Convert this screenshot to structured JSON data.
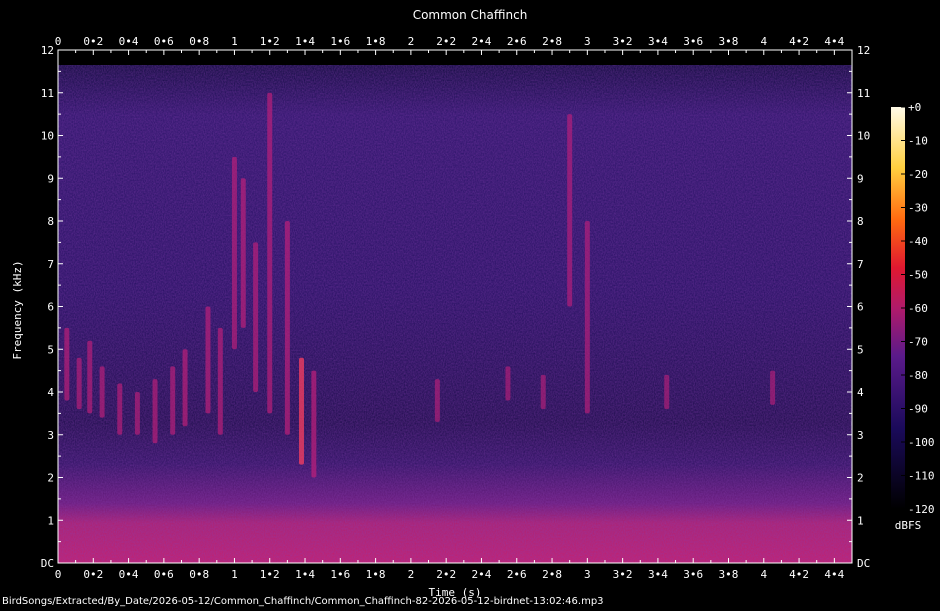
{
  "chart_data": {
    "type": "heatmap",
    "title": "Common Chaffinch",
    "xlabel": "Time (s)",
    "ylabel": "Frequency (kHz)",
    "xlim": [
      0,
      4.5
    ],
    "ylim": [
      0,
      12
    ],
    "x_ticks": [
      "0",
      "0•2",
      "0•4",
      "0•6",
      "0•8",
      "1",
      "1•2",
      "1•4",
      "1•6",
      "1•8",
      "2",
      "2•2",
      "2•4",
      "2•6",
      "2•8",
      "3",
      "3•2",
      "3•4",
      "3•6",
      "3•8",
      "4",
      "4•2",
      "4•4"
    ],
    "x_tick_values": [
      0,
      0.2,
      0.4,
      0.6,
      0.8,
      1.0,
      1.2,
      1.4,
      1.6,
      1.8,
      2.0,
      2.2,
      2.4,
      2.6,
      2.8,
      3.0,
      3.2,
      3.4,
      3.6,
      3.8,
      4.0,
      4.2,
      4.4
    ],
    "y_ticks": [
      "DC",
      "1",
      "2",
      "3",
      "4",
      "5",
      "6",
      "7",
      "8",
      "9",
      "10",
      "11",
      "12"
    ],
    "y_tick_values": [
      0,
      1,
      2,
      3,
      4,
      5,
      6,
      7,
      8,
      9,
      10,
      11,
      12
    ],
    "colorbar": {
      "label": "dBFS",
      "ticks": [
        "+0",
        "-10",
        "-20",
        "-30",
        "-40",
        "-50",
        "-60",
        "-70",
        "-80",
        "-90",
        "-100",
        "-110",
        "-120"
      ],
      "tick_values": [
        0,
        -10,
        -20,
        -30,
        -40,
        -50,
        -60,
        -70,
        -80,
        -90,
        -100,
        -110,
        -120
      ],
      "range": [
        -120,
        0
      ]
    },
    "colors": {
      "background": "#000000",
      "low": "#0a0930",
      "mid": "#3a1a7a",
      "high": "#c0207a",
      "peak": "#ff4060",
      "max": "#fffbe0"
    },
    "events": [
      {
        "t": 0.05,
        "f_low": 3.8,
        "f_high": 5.5,
        "level": -65
      },
      {
        "t": 0.12,
        "f_low": 3.6,
        "f_high": 4.8,
        "level": -68
      },
      {
        "t": 0.18,
        "f_low": 3.5,
        "f_high": 5.2,
        "level": -66
      },
      {
        "t": 0.25,
        "f_low": 3.4,
        "f_high": 4.6,
        "level": -67
      },
      {
        "t": 0.35,
        "f_low": 3.0,
        "f_high": 4.2,
        "level": -66
      },
      {
        "t": 0.45,
        "f_low": 3.0,
        "f_high": 4.0,
        "level": -68
      },
      {
        "t": 0.55,
        "f_low": 2.8,
        "f_high": 4.3,
        "level": -66
      },
      {
        "t": 0.65,
        "f_low": 3.0,
        "f_high": 4.6,
        "level": -67
      },
      {
        "t": 0.72,
        "f_low": 3.2,
        "f_high": 5.0,
        "level": -64
      },
      {
        "t": 0.85,
        "f_low": 3.5,
        "f_high": 6.0,
        "level": -63
      },
      {
        "t": 0.92,
        "f_low": 3.0,
        "f_high": 5.5,
        "level": -65
      },
      {
        "t": 1.0,
        "f_low": 5.0,
        "f_high": 9.5,
        "level": -66
      },
      {
        "t": 1.05,
        "f_low": 5.5,
        "f_high": 9.0,
        "level": -64
      },
      {
        "t": 1.12,
        "f_low": 4.0,
        "f_high": 7.5,
        "level": -65
      },
      {
        "t": 1.2,
        "f_low": 3.5,
        "f_high": 11.0,
        "level": -65
      },
      {
        "t": 1.3,
        "f_low": 3.0,
        "f_high": 8.0,
        "level": -62
      },
      {
        "t": 1.38,
        "f_low": 2.3,
        "f_high": 4.8,
        "level": -55
      },
      {
        "t": 1.45,
        "f_low": 2.0,
        "f_high": 4.5,
        "level": -60
      },
      {
        "t": 2.15,
        "f_low": 3.3,
        "f_high": 4.3,
        "level": -72
      },
      {
        "t": 2.55,
        "f_low": 3.8,
        "f_high": 4.6,
        "level": -74
      },
      {
        "t": 2.75,
        "f_low": 3.6,
        "f_high": 4.4,
        "level": -73
      },
      {
        "t": 2.9,
        "f_low": 6.0,
        "f_high": 10.5,
        "level": -70
      },
      {
        "t": 3.0,
        "f_low": 3.5,
        "f_high": 8.0,
        "level": -70
      },
      {
        "t": 3.45,
        "f_low": 3.6,
        "f_high": 4.4,
        "level": -75
      },
      {
        "t": 4.05,
        "f_low": 3.7,
        "f_high": 4.5,
        "level": -74
      }
    ]
  },
  "file_path": "BirdSongs/Extracted/By_Date/2026-05-12/Common_Chaffinch/Common_Chaffinch-82-2026-05-12-birdnet-13:02:46.mp3"
}
